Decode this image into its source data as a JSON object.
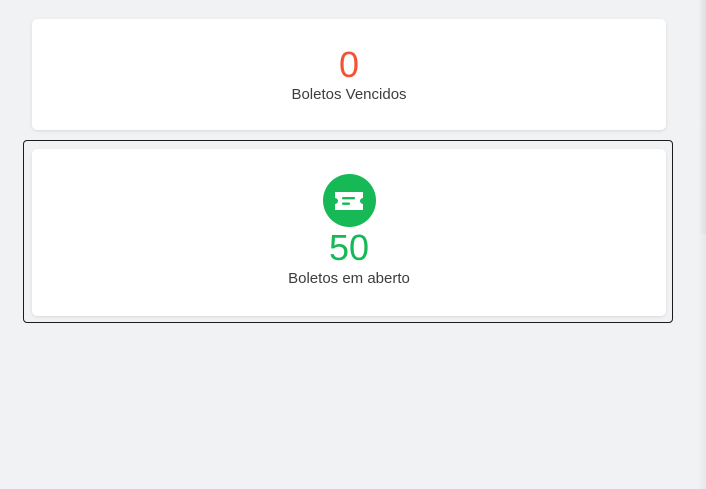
{
  "cards": [
    {
      "count": "0",
      "label": "Boletos Vencidos",
      "count_color": "#f25433"
    },
    {
      "count": "50",
      "label": "Boletos em aberto",
      "icon": "ticket-icon",
      "count_color": "#16b955"
    }
  ]
}
